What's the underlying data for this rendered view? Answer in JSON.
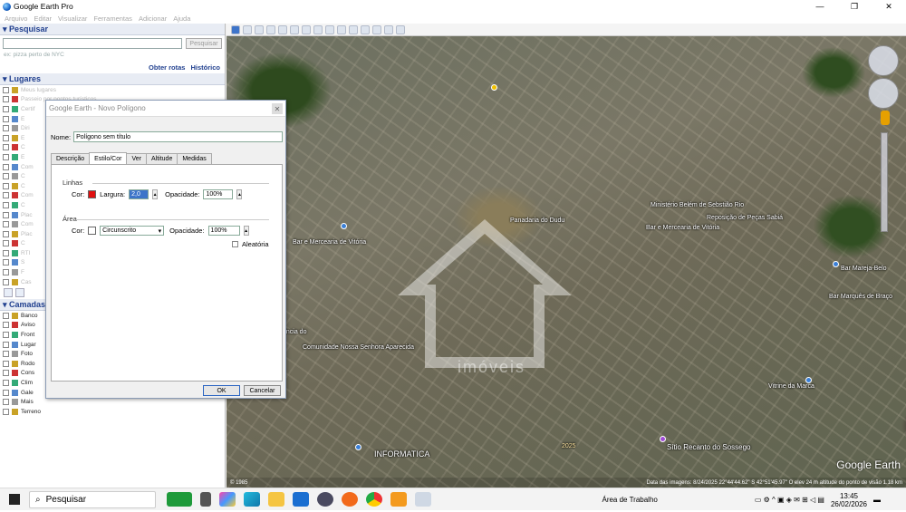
{
  "window": {
    "title": "Google Earth Pro"
  },
  "menu": [
    "Arquivo",
    "Editar",
    "Visualizar",
    "Ferramentas",
    "Adicionar",
    "Ajuda"
  ],
  "search": {
    "header": "Pesquisar",
    "button": "Pesquisar",
    "hint": "ex: pizza perto de NYC",
    "links": [
      "Obter rotas",
      "Histórico"
    ]
  },
  "places": {
    "header": "Lugares",
    "items": [
      "Meus lugares",
      "Passeio por pontos turísticos",
      "Certif",
      "E",
      "Diri",
      "E",
      "C",
      "E",
      "Com",
      "C",
      "C",
      "Com",
      "C",
      "Plac",
      "Com",
      "Plac",
      "C",
      "RTI",
      "S",
      "F",
      "Cas",
      "C"
    ]
  },
  "layers": {
    "header": "Camadas",
    "items": [
      "Banco",
      "Aviso",
      "Front",
      "Lugar",
      "Foto",
      "Rodo",
      "Cons",
      "Clim",
      "Gale",
      "Mais",
      "Terreno"
    ]
  },
  "dialog": {
    "title": "Google Earth - Novo Polígono",
    "name_label": "Nome:",
    "name_value": "Polígono sem título",
    "tabs": [
      "Descrição",
      "Estilo/Cor",
      "Ver",
      "Altitude",
      "Medidas"
    ],
    "active_tab": "Estilo/Cor",
    "lines": {
      "header": "Linhas",
      "color_label": "Cor:",
      "color": "#e01010",
      "width_label": "Largura:",
      "width_value": "2,0",
      "opacity_label": "Opacidade:",
      "opacity_value": "100%"
    },
    "area": {
      "header": "Área",
      "color_label": "Cor:",
      "color": "#ffffff",
      "fill_mode": "Circunscrito",
      "opacity_label": "Opacidade:",
      "opacity_value": "100%",
      "random_label": "Aleatória"
    },
    "ok": "OK",
    "cancel": "Cancelar"
  },
  "map": {
    "labels": [
      "Comunidade Nossa Senhora Aparecida",
      "Panadaria do Dudu",
      "Ministério Belém de Sebstião Rio",
      "Bar e Mercearia de Vitória",
      "Bar e Mercearia de Vitória",
      "Reposição de Peças Sabiá",
      "Vitrine da Marca",
      "INFORMATICA",
      "Sítio Recanto do Sossego",
      "Bar Mareja-Belo",
      "Bar Marquês de Braço",
      "ência do"
    ],
    "watermark": "imóveis",
    "logo": "Google Earth",
    "status_left": "© 1985",
    "status_right": "Data das imagens: 8/24/2025   22°44'44.62\" S  42°51'45.97\" O  elev 24 m  altitude do ponto de visão  1.18 km",
    "date_overlay": "2025"
  },
  "taskbar": {
    "search_placeholder": "Pesquisar",
    "desktop": "Área de Trabalho",
    "time": "13:45",
    "date": "26/02/2026"
  }
}
